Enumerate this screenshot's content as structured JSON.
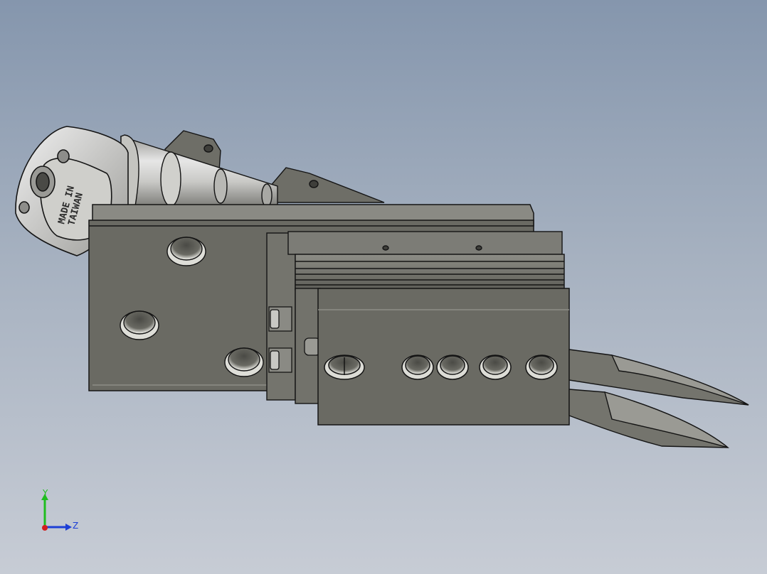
{
  "viewport": {
    "background_top": "#8596ad",
    "background_bottom": "#c7ccd5"
  },
  "model": {
    "engraving_line1": "MADE IN",
    "engraving_line2": "TAIWAN",
    "body_color": "#6a6a63",
    "edge_color": "#141414",
    "metal_color": "#c9c9c9"
  },
  "triad": {
    "y_label": "Y",
    "z_label": "Z",
    "y_color": "#1fbd1f",
    "z_color": "#1d3fd6",
    "x_color": "#d21e1e"
  }
}
